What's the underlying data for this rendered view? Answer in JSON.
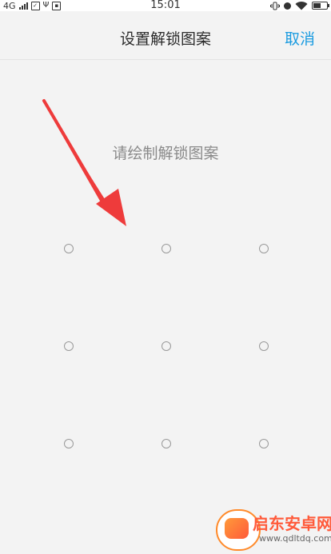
{
  "status_bar": {
    "network": "4G",
    "time": "15:01"
  },
  "nav": {
    "title": "设置解锁图案",
    "cancel_label": "取消"
  },
  "prompt": "请绘制解锁图案",
  "pattern_dots": [
    "dot-1",
    "dot-2",
    "dot-3",
    "dot-4",
    "dot-5",
    "dot-6",
    "dot-7",
    "dot-8",
    "dot-9"
  ],
  "watermark": {
    "title": "启东安卓网",
    "url": "www.qdltdq.com"
  },
  "colors": {
    "accent": "#1a9be0",
    "arrow": "#ee3b3b",
    "background": "#f3f3f3",
    "prompt_text": "#8a8a8a"
  },
  "icons": [
    "signal-icon",
    "message-icon",
    "usb-icon",
    "sim-icon",
    "vibrate-icon",
    "alarm-icon",
    "wifi-icon",
    "battery-icon"
  ]
}
